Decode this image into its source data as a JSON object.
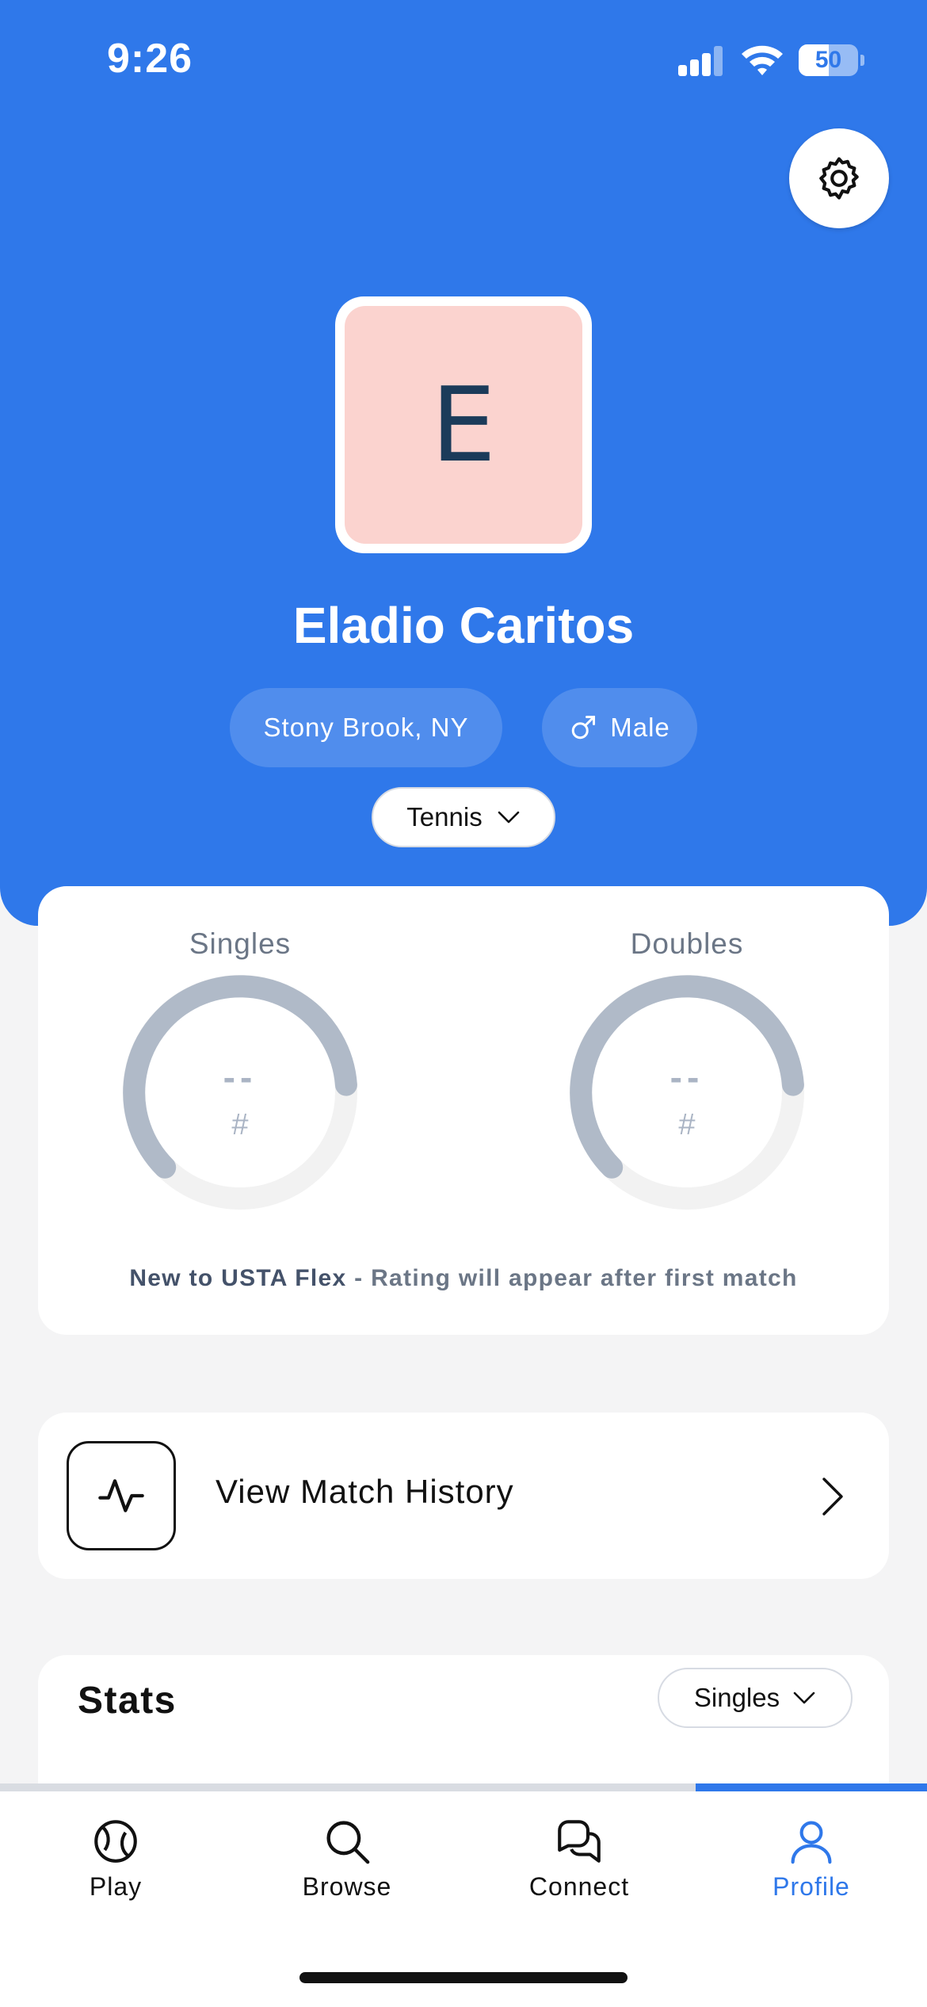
{
  "status_bar": {
    "time": "9:26",
    "battery": "50",
    "battery_level": 0.5,
    "signal_bars_filled": 3,
    "signal_bars_total": 4
  },
  "profile": {
    "avatar_letter": "E",
    "name": "Eladio Caritos",
    "location": "Stony Brook, NY",
    "gender": "Male",
    "sport": "Tennis"
  },
  "ratings": {
    "singles": {
      "title": "Singles",
      "value": "--",
      "hash": "#"
    },
    "doubles": {
      "title": "Doubles",
      "value": "--",
      "hash": "#"
    },
    "note_bold": "New to USTA Flex",
    "note_rest": " - Rating will appear after first match"
  },
  "match_history": {
    "label": "View Match History"
  },
  "stats": {
    "title": "Stats",
    "filter": "Singles"
  },
  "tabs": [
    {
      "label": "Play",
      "icon": "tennis-ball-icon"
    },
    {
      "label": "Browse",
      "icon": "search-icon"
    },
    {
      "label": "Connect",
      "icon": "chat-icon"
    },
    {
      "label": "Profile",
      "icon": "profile-icon",
      "active": true
    }
  ],
  "colors": {
    "brand_blue": "#2f78ea",
    "avatar_bg": "#fbd3cf",
    "gauge_fill": "#b0bac8",
    "gauge_track": "#f2f2f2"
  }
}
